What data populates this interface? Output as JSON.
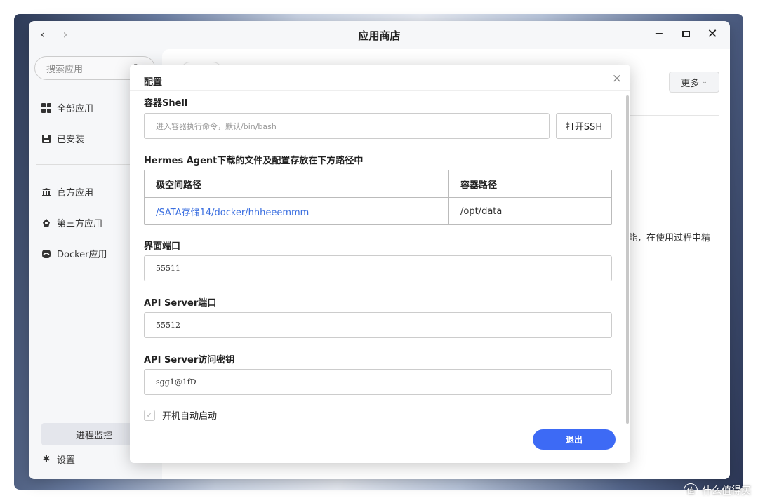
{
  "window": {
    "title": "应用商店",
    "back_icon": "‹",
    "forward_icon": "›",
    "minimize_icon": "−",
    "close_icon": "✕"
  },
  "sidebar": {
    "search_placeholder": "搜索应用",
    "items": [
      {
        "label": "全部应用",
        "icon": "grid-icon"
      },
      {
        "label": "已安装",
        "icon": "save-icon"
      },
      {
        "label": "官方应用",
        "icon": "bank-icon"
      },
      {
        "label": "第三方应用",
        "icon": "badge-icon"
      },
      {
        "label": "Docker应用",
        "icon": "docker-icon"
      }
    ],
    "monitor_label": "进程监控",
    "settings_label": "设置"
  },
  "main": {
    "more_label": "更多",
    "partial_text": "能，在使用过程中精"
  },
  "modal": {
    "title": "配置",
    "close_icon": "×",
    "shell": {
      "label": "容器Shell",
      "placeholder": "进入容器执行命令，默认/bin/bash",
      "ssh_button": "打开SSH"
    },
    "storage": {
      "label": "Hermes Agent下载的文件及配置存放在下方路径中",
      "headers": [
        "极空间路径",
        "容器路径"
      ],
      "rows": [
        [
          "/SATA存储14/docker/hhheeemmm",
          "/opt/data"
        ]
      ]
    },
    "ui_port": {
      "label": "界面端口",
      "value": "55511"
    },
    "api_port": {
      "label": "API Server端口",
      "value": "55512"
    },
    "api_key": {
      "label": "API Server访问密钥",
      "value": "sgg1@1fD"
    },
    "autostart_label": "开机自动启动",
    "exit_button": "退出"
  },
  "watermark": {
    "icon_text": "值",
    "text": "什么值得买"
  },
  "colors": {
    "accent": "#3d6af5",
    "link": "#3b6fe0"
  }
}
